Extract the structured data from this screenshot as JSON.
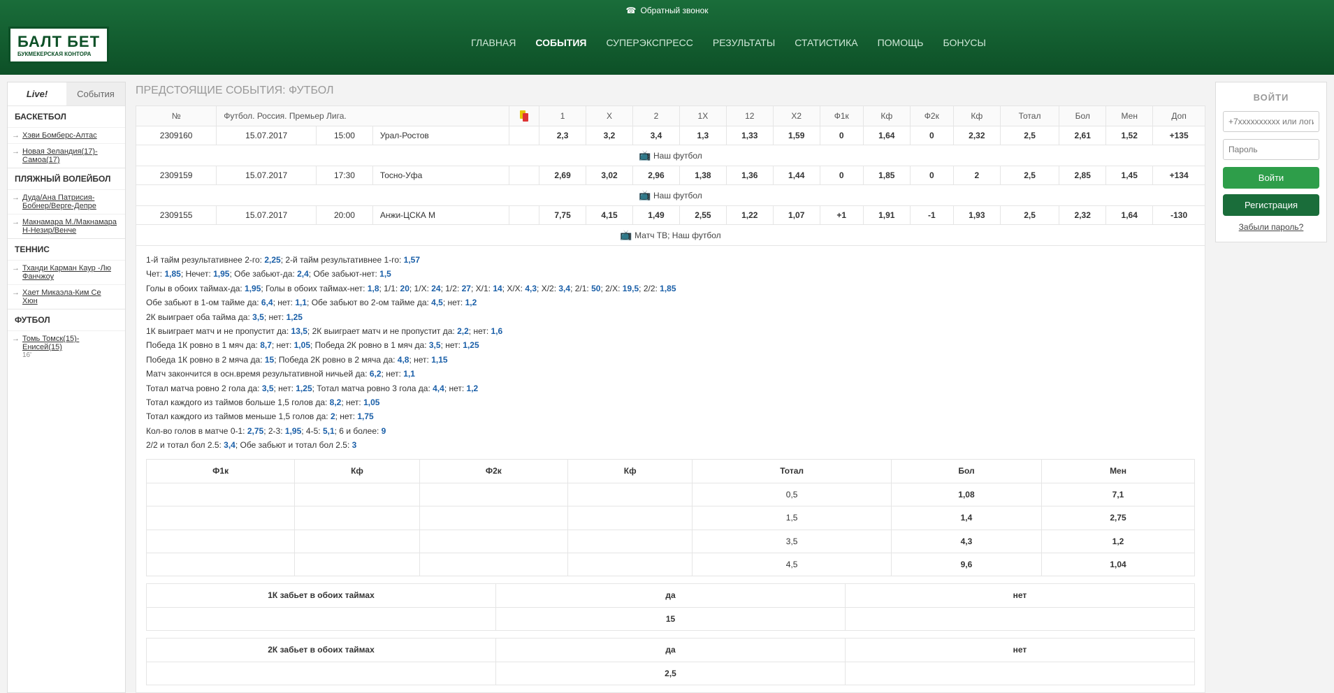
{
  "header": {
    "callback": "Обратный звонок",
    "logo_main": "БАЛТ БЕТ",
    "logo_sub": "БУКМЕКЕРСКАЯ КОНТОРА",
    "nav": [
      "ГЛАВНАЯ",
      "СОБЫТИЯ",
      "СУПЕРЭКСПРЕСС",
      "РЕЗУЛЬТАТЫ",
      "СТАТИСТИКА",
      "ПОМОЩЬ",
      "БОНУСЫ"
    ],
    "nav_active": 1
  },
  "sidebar": {
    "tab_live": "Live!",
    "tab_events": "События",
    "cats": [
      {
        "name": "БАСКЕТБОЛ",
        "items": [
          {
            "t": "Хэви Бомберс-Алтас"
          },
          {
            "t": "Новая Зеландия(17)-Самоа(17)"
          }
        ]
      },
      {
        "name": "ПЛЯЖНЫЙ ВОЛЕЙБОЛ",
        "items": [
          {
            "t": "Дуда/Ана Патрисия-Бобнер/Верге-Депре"
          },
          {
            "t": "Макнамара М./Макнамара Н-Незир/Венче"
          }
        ]
      },
      {
        "name": "ТЕННИС",
        "items": [
          {
            "t": "Тханди Карман Каур -Лю Фанчжоу"
          },
          {
            "t": "Хает Микаэла-Ким Се Хюн"
          }
        ]
      },
      {
        "name": "ФУТБОЛ",
        "items": [
          {
            "t": "Томь Томск(15)-Енисей(15)",
            "time": "16'"
          }
        ]
      }
    ]
  },
  "page_title": "ПРЕДСТОЯЩИЕ СОБЫТИЯ: ФУТБОЛ",
  "columns": [
    "№",
    "Футбол. Россия. Премьер Лига.",
    "",
    "1",
    "X",
    "2",
    "1X",
    "12",
    "X2",
    "Ф1к",
    "Кф",
    "Ф2к",
    "Кф",
    "Тотал",
    "Бол",
    "Мен",
    "Доп"
  ],
  "rows": [
    {
      "no": "2309160",
      "date": "15.07.2017",
      "time": "15:00",
      "match": "Урал-Ростов",
      "o": [
        "2,3",
        "3,2",
        "3,4",
        "1,3",
        "1,33",
        "1,59",
        "0",
        "1,64",
        "0",
        "2,32",
        "2,5",
        "2,61",
        "1,52",
        "+135"
      ],
      "tv": "Наш футбол"
    },
    {
      "no": "2309159",
      "date": "15.07.2017",
      "time": "17:30",
      "match": "Тосно-Уфа",
      "o": [
        "2,69",
        "3,02",
        "2,96",
        "1,38",
        "1,36",
        "1,44",
        "0",
        "1,85",
        "0",
        "2",
        "2,5",
        "2,85",
        "1,45",
        "+134"
      ],
      "tv": "Наш футбол"
    },
    {
      "no": "2309155",
      "date": "15.07.2017",
      "time": "20:00",
      "match": "Анжи-ЦСКА М",
      "o": [
        "7,75",
        "4,15",
        "1,49",
        "2,55",
        "1,22",
        "1,07",
        "+1",
        "1,91",
        "-1",
        "1,93",
        "2,5",
        "2,32",
        "1,64",
        "-130"
      ],
      "tv": "Матч ТВ; Наш футбол"
    }
  ],
  "details": [
    [
      {
        "t": "1-й тайм результативнее 2-го:"
      },
      {
        "v": "2,25"
      },
      {
        "t": "; 2-й тайм результативнее 1-го:"
      },
      {
        "v": "1,57"
      }
    ],
    [
      {
        "t": "Чет:"
      },
      {
        "v": "1,85"
      },
      {
        "t": "; Нечет:"
      },
      {
        "v": "1,95"
      },
      {
        "t": "; Обе забьют-да:"
      },
      {
        "v": "2,4"
      },
      {
        "t": "; Обе забьют-нет:"
      },
      {
        "v": "1,5"
      }
    ],
    [
      {
        "t": "Голы в обоих таймах-да:"
      },
      {
        "v": "1,95"
      },
      {
        "t": "; Голы в обоих таймах-нет:"
      },
      {
        "v": "1,8"
      },
      {
        "t": "; 1/1:"
      },
      {
        "v": "20"
      },
      {
        "t": "; 1/X:"
      },
      {
        "v": "24"
      },
      {
        "t": "; 1/2:"
      },
      {
        "v": "27"
      },
      {
        "t": "; X/1:"
      },
      {
        "v": "14"
      },
      {
        "t": "; X/X:"
      },
      {
        "v": "4,3"
      },
      {
        "t": "; X/2:"
      },
      {
        "v": "3,4"
      },
      {
        "t": "; 2/1:"
      },
      {
        "v": "50"
      },
      {
        "t": "; 2/X:"
      },
      {
        "v": "19,5"
      },
      {
        "t": "; 2/2:"
      },
      {
        "v": "1,85"
      }
    ],
    [
      {
        "t": "Обе забьют в 1-ом тайме да:"
      },
      {
        "v": "6,4"
      },
      {
        "t": "; нет:"
      },
      {
        "v": "1,1"
      },
      {
        "t": "; Обе забьют во 2-ом тайме да:"
      },
      {
        "v": "4,5"
      },
      {
        "t": "; нет:"
      },
      {
        "v": "1,2"
      }
    ],
    [
      {
        "t": "2К выиграет оба тайма да:"
      },
      {
        "v": "3,5"
      },
      {
        "t": "; нет:"
      },
      {
        "v": "1,25"
      }
    ],
    [
      {
        "t": "1К выиграет матч и не пропустит да:"
      },
      {
        "v": "13,5"
      },
      {
        "t": "; 2К выиграет матч и не пропустит да:"
      },
      {
        "v": "2,2"
      },
      {
        "t": "; нет:"
      },
      {
        "v": "1,6"
      }
    ],
    [
      {
        "t": "Победа 1К ровно в 1 мяч да:"
      },
      {
        "v": "8,7"
      },
      {
        "t": "; нет:"
      },
      {
        "v": "1,05"
      },
      {
        "t": "; Победа 2К ровно в 1 мяч да:"
      },
      {
        "v": "3,5"
      },
      {
        "t": "; нет:"
      },
      {
        "v": "1,25"
      }
    ],
    [
      {
        "t": "Победа 1К ровно в 2 мяча да:"
      },
      {
        "v": "15"
      },
      {
        "t": "; Победа 2К ровно в 2 мяча да:"
      },
      {
        "v": "4,8"
      },
      {
        "t": "; нет:"
      },
      {
        "v": "1,15"
      }
    ],
    [
      {
        "t": "Матч закончится в осн.время результативной ничьей да:"
      },
      {
        "v": "6,2"
      },
      {
        "t": "; нет:"
      },
      {
        "v": "1,1"
      }
    ],
    [
      {
        "t": "Тотал матча ровно 2 гола да:"
      },
      {
        "v": "3,5"
      },
      {
        "t": "; нет:"
      },
      {
        "v": "1,25"
      },
      {
        "t": "; Тотал матча ровно 3 гола да:"
      },
      {
        "v": "4,4"
      },
      {
        "t": "; нет:"
      },
      {
        "v": "1,2"
      }
    ],
    [
      {
        "t": "Тотал каждого из таймов больше 1,5 голов да:"
      },
      {
        "v": "8,2"
      },
      {
        "t": "; нет:"
      },
      {
        "v": "1,05"
      }
    ],
    [
      {
        "t": "Тотал каждого из таймов меньше 1,5 голов да:"
      },
      {
        "v": "2"
      },
      {
        "t": "; нет:"
      },
      {
        "v": "1,75"
      }
    ],
    [
      {
        "t": "Кол-во голов в матче 0-1:"
      },
      {
        "v": "2,75"
      },
      {
        "t": "; 2-3:"
      },
      {
        "v": "1,95"
      },
      {
        "t": "; 4-5:"
      },
      {
        "v": "5,1"
      },
      {
        "t": "; 6 и более:"
      },
      {
        "v": "9"
      }
    ],
    [
      {
        "t": "2/2 и тотал бол 2.5:"
      },
      {
        "v": "3,4"
      },
      {
        "t": "; Обе забьют и тотал бол 2.5:"
      },
      {
        "v": "3"
      }
    ]
  ],
  "fora_headers": [
    "Ф1к",
    "Кф",
    "Ф2к",
    "Кф",
    "Тотал",
    "Бол",
    "Мен"
  ],
  "fora_rows": [
    [
      "",
      "",
      "",
      "",
      "0,5",
      "1,08",
      "7,1"
    ],
    [
      "",
      "",
      "",
      "",
      "1,5",
      "1,4",
      "2,75"
    ],
    [
      "",
      "",
      "",
      "",
      "3,5",
      "4,3",
      "1,2"
    ],
    [
      "",
      "",
      "",
      "",
      "4,5",
      "9,6",
      "1,04"
    ]
  ],
  "extras": [
    {
      "h": [
        "1К забьет в обоих таймах",
        "да",
        "нет"
      ],
      "r": [
        "",
        "15",
        ""
      ]
    },
    {
      "h": [
        "2К забьет в обоих таймах",
        "да",
        "нет"
      ],
      "r": [
        "",
        "2,5",
        ""
      ]
    }
  ],
  "login": {
    "title": "ВОЙТИ",
    "ph_login": "+7xxxxxxxxxx или логин",
    "ph_pass": "Пароль",
    "btn_login": "Войти",
    "btn_reg": "Регистрация",
    "forgot": "Забыли пароль?"
  }
}
